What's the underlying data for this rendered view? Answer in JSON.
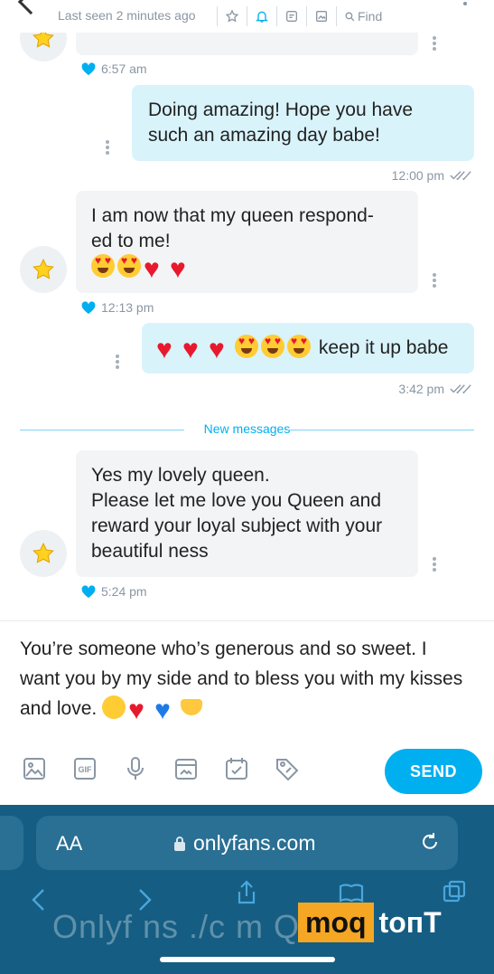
{
  "header": {
    "last_seen": "Last seen 2 minutes ago",
    "find_label": "Find"
  },
  "messages": [
    {
      "id": "m0",
      "from": "them",
      "time": "6:57 am"
    },
    {
      "id": "m1",
      "from": "me",
      "text": "Doing amazing! Hope you have such an amazing day babe!",
      "time": "12:00 pm"
    },
    {
      "id": "m2",
      "from": "them",
      "text_line1": "I am now that my queen respond-",
      "text_line2": "ed to me!",
      "emojis": [
        "heart-eyes",
        "heart-eyes",
        "red-heart",
        "red-heart"
      ],
      "time": "12:13 pm"
    },
    {
      "id": "m3",
      "from": "me",
      "emojis": [
        "red-heart",
        "red-heart",
        "red-heart",
        "heart-eyes",
        "heart-eyes",
        "heart-eyes"
      ],
      "text": "keep it up babe",
      "time": "3:42 pm"
    },
    {
      "id": "m4",
      "from": "them",
      "text_line1": "Yes my lovely queen.",
      "text_line2": "Please let me love you Queen and reward your loyal subject with your beautiful ness",
      "time": "5:24 pm"
    }
  ],
  "divider": {
    "new_messages": "New messages"
  },
  "composer": {
    "text": "You’re someone who’s generous and so sweet. I want you by my side and to bless you with my kisses and love.",
    "emojis": [
      "grinning-face",
      "red-heart",
      "blue-heart",
      "heart-hands"
    ],
    "send_label": "SEND",
    "tools": [
      "image-icon",
      "gif-icon",
      "microphone-icon",
      "vault-icon",
      "schedule-icon",
      "price-tag-icon"
    ]
  },
  "browser": {
    "aa_label": "AA",
    "url": "onlyfans.com",
    "watermark": "Onlyf ns ./c m Q",
    "badge_left": "moq",
    "badge_right": "toпT"
  },
  "colors": {
    "accent": "#00aff0",
    "incoming_bubble": "#f2f4f5",
    "outgoing_bubble": "#d9f3fb",
    "browser_bar": "#155d82"
  }
}
